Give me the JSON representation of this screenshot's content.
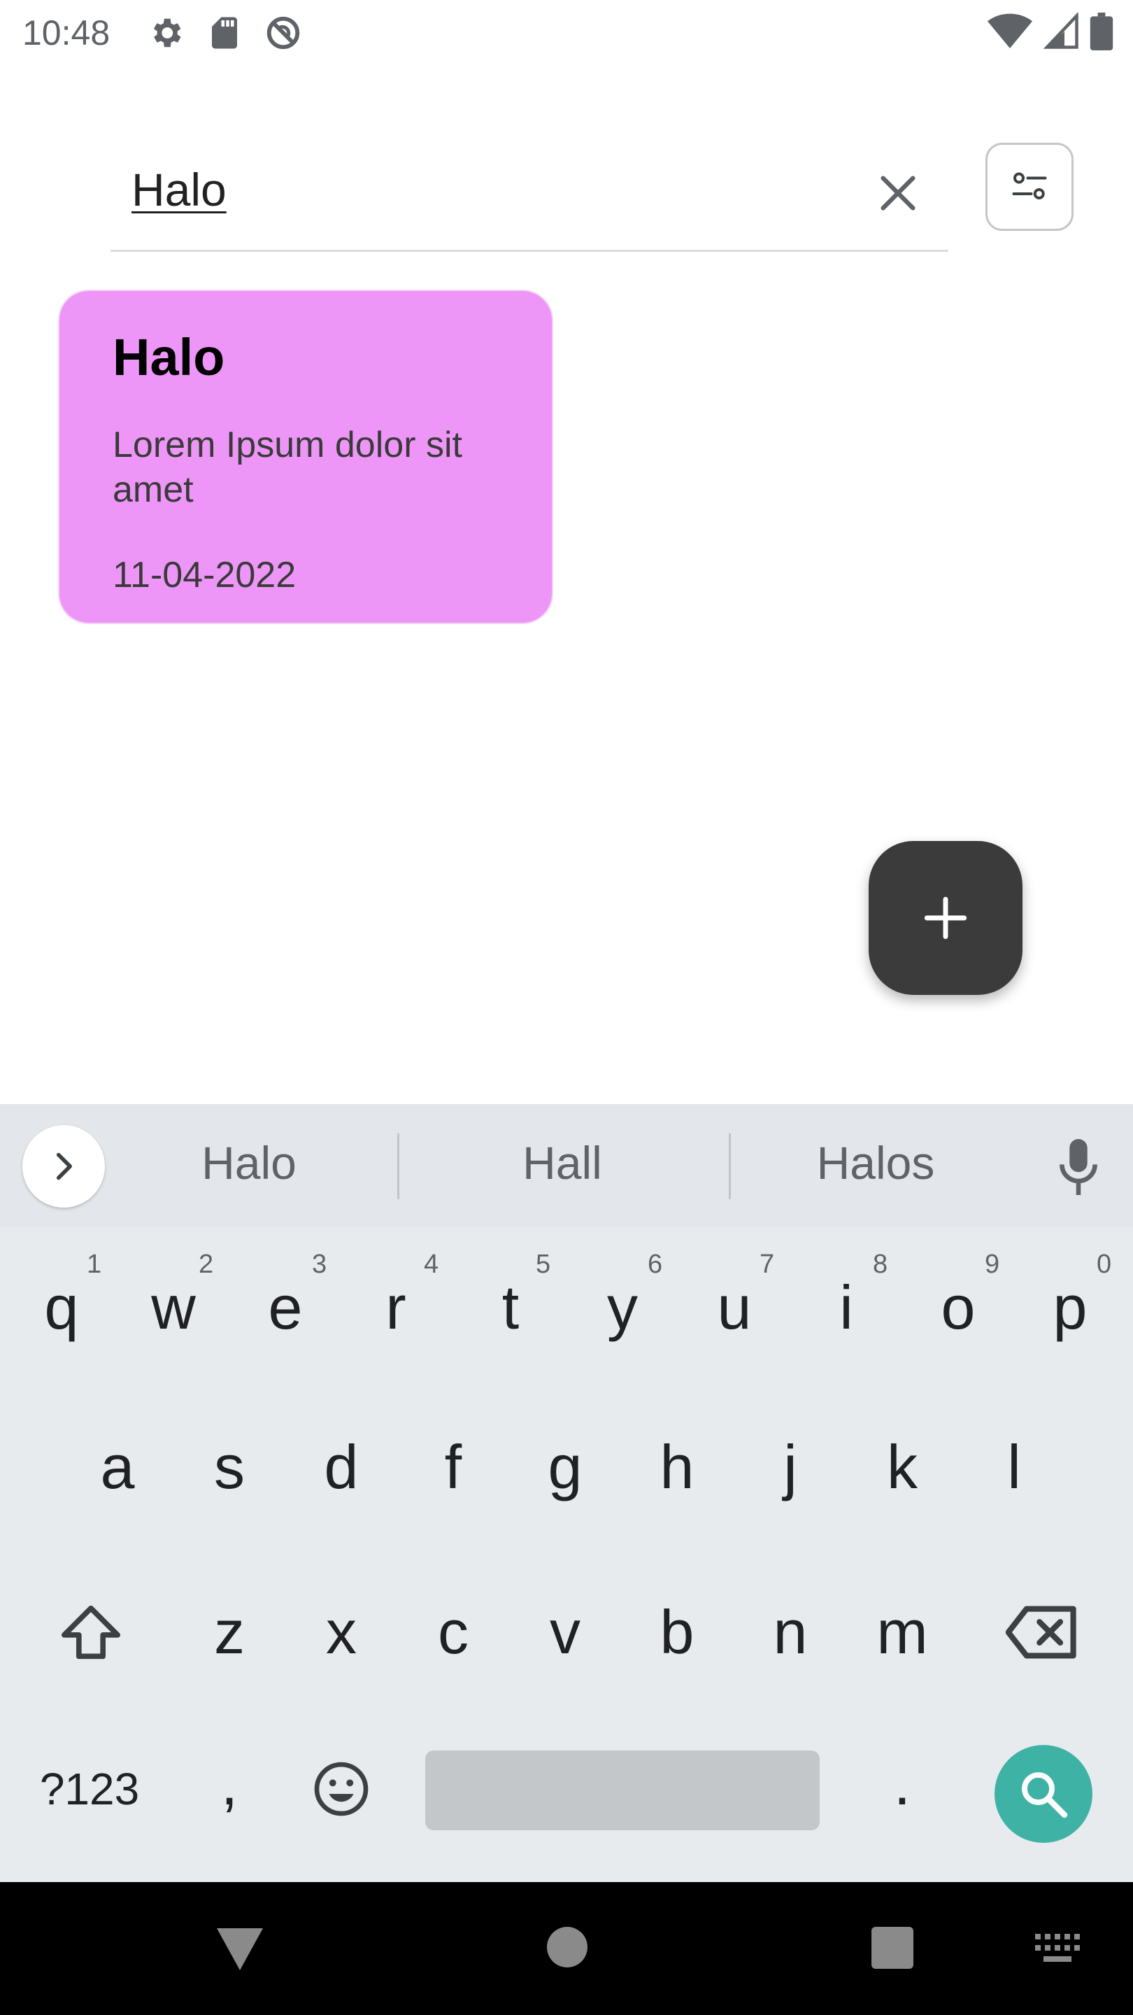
{
  "status_bar": {
    "time": "10:48",
    "left_icons": [
      "settings-icon",
      "sd-card-icon",
      "no-disturb-icon"
    ],
    "right_icons": [
      "wifi-icon",
      "signal-icon",
      "battery-icon"
    ]
  },
  "search": {
    "value": "Halo",
    "clear_icon": "close-icon",
    "filter_icon": "filter-icon"
  },
  "notes": [
    {
      "title": "Halo",
      "body": "Lorem Ipsum dolor sit amet",
      "date": "11-04-2022",
      "color": "#ee96f8"
    }
  ],
  "fab": {
    "icon": "plus-icon",
    "color": "#3b3b3b"
  },
  "keyboard": {
    "suggestions": [
      "Halo",
      "Hall",
      "Halos"
    ],
    "row1": [
      "q",
      "w",
      "e",
      "r",
      "t",
      "y",
      "u",
      "i",
      "o",
      "p"
    ],
    "row1_hints": [
      "1",
      "2",
      "3",
      "4",
      "5",
      "6",
      "7",
      "8",
      "9",
      "0"
    ],
    "row2": [
      "a",
      "s",
      "d",
      "f",
      "g",
      "h",
      "j",
      "k",
      "l"
    ],
    "row3": [
      "z",
      "x",
      "c",
      "v",
      "b",
      "n",
      "m"
    ],
    "symbols_label": "?123",
    "comma": ",",
    "period": ".",
    "action_color": "#3fb2a6"
  },
  "nav_bar": {
    "icons": [
      "back-icon",
      "home-icon",
      "recents-icon",
      "keyboard-switch-icon"
    ]
  }
}
